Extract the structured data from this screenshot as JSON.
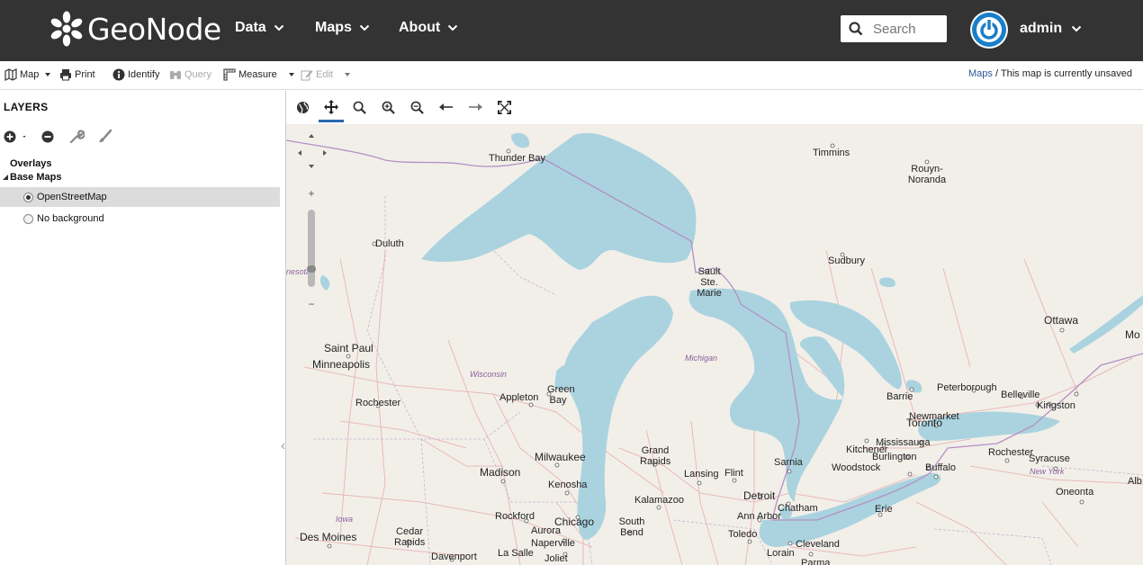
{
  "header": {
    "logo_text": "GeoNode",
    "nav": [
      {
        "label": "Data"
      },
      {
        "label": "Maps"
      },
      {
        "label": "About"
      }
    ],
    "search_placeholder": "Search",
    "user": "admin",
    "colors": {
      "bar": "#333333",
      "avatar": "#1a7ec8"
    }
  },
  "toolbar": {
    "map": "Map",
    "print": "Print",
    "identify": "Identify",
    "query": "Query",
    "measure": "Measure",
    "edit": "Edit",
    "breadcrumb_link": "Maps",
    "breadcrumb_text": " / This map is currently unsaved"
  },
  "layers": {
    "title": "LAYERS",
    "groups": [
      {
        "label": "Overlays"
      },
      {
        "label": "Base Maps"
      }
    ],
    "base_maps": [
      {
        "label": "OpenStreetMap",
        "selected": true
      },
      {
        "label": "No background",
        "selected": false
      }
    ],
    "icons": [
      "add-icon",
      "remove-icon",
      "wrench-icon",
      "brush-icon"
    ]
  },
  "map": {
    "tools": [
      "globe-icon",
      "pan-icon",
      "search-icon",
      "zoom-in-icon",
      "zoom-out-icon",
      "back-icon",
      "forward-icon",
      "fullscreen-icon"
    ],
    "zoom": {
      "plus": "+",
      "minus": "−"
    },
    "colors": {
      "land": "#f2efe9",
      "water": "#aad3df",
      "border": "#b58fc2",
      "road": "#e5a7a7"
    },
    "labels": [
      {
        "text": "Thunder Bay"
      },
      {
        "text": "Timmins"
      },
      {
        "text": "Rouyn-Noranda"
      },
      {
        "text": "Duluth"
      },
      {
        "text": "Sudbury"
      },
      {
        "text": "Sault Ste. Marie"
      },
      {
        "text": "Ottawa"
      },
      {
        "text": "Saint Paul"
      },
      {
        "text": "Minneapolis"
      },
      {
        "text": "Wisconsin"
      },
      {
        "text": "Michigan"
      },
      {
        "text": "Green Bay"
      },
      {
        "text": "Appleton"
      },
      {
        "text": "Rochester"
      },
      {
        "text": "Peterborough"
      },
      {
        "text": "Barrie"
      },
      {
        "text": "Belleville"
      },
      {
        "text": "Kingston"
      },
      {
        "text": "Newmarket"
      },
      {
        "text": "Toronto"
      },
      {
        "text": "Mississauga"
      },
      {
        "text": "Kitchener"
      },
      {
        "text": "Burlington"
      },
      {
        "text": "Rochester"
      },
      {
        "text": "Syracuse"
      },
      {
        "text": "New York"
      },
      {
        "text": "Milwaukee"
      },
      {
        "text": "Grand Rapids"
      },
      {
        "text": "Madison"
      },
      {
        "text": "Lansing"
      },
      {
        "text": "Flint"
      },
      {
        "text": "Sarnia"
      },
      {
        "text": "Woodstock"
      },
      {
        "text": "Buffalo"
      },
      {
        "text": "Kenosha"
      },
      {
        "text": "Detroit"
      },
      {
        "text": "Kalamazoo"
      },
      {
        "text": "Chatham"
      },
      {
        "text": "Oneonta"
      },
      {
        "text": "Iowa"
      },
      {
        "text": "Rockford"
      },
      {
        "text": "Chicago"
      },
      {
        "text": "Ann Arbor"
      },
      {
        "text": "Erie"
      },
      {
        "text": "Aurora"
      },
      {
        "text": "South Bend"
      },
      {
        "text": "Des Moines"
      },
      {
        "text": "Cedar Rapids"
      },
      {
        "text": "Naperville"
      },
      {
        "text": "Toledo"
      },
      {
        "text": "Cleveland"
      },
      {
        "text": "Lorain"
      },
      {
        "text": "La Salle"
      },
      {
        "text": "Davenport"
      },
      {
        "text": "Joliet"
      },
      {
        "text": "Mo"
      },
      {
        "text": "Alb"
      },
      {
        "text": "nesota"
      },
      {
        "text": "Parma"
      }
    ]
  }
}
